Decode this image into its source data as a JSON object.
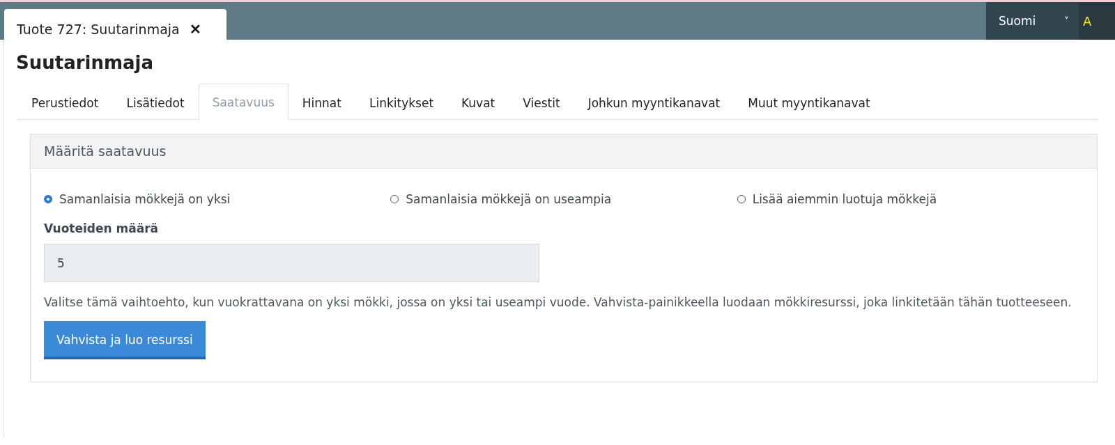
{
  "document_tab": {
    "title": "Tuote 727: Suutarinmaja",
    "close": "✕"
  },
  "language": {
    "value": "Suomi",
    "caret": "˅"
  },
  "top_right_cut": "A",
  "title": "Suutarinmaja",
  "tabs": [
    {
      "label": "Perustiedot",
      "selected": false
    },
    {
      "label": "Lisätiedot",
      "selected": false
    },
    {
      "label": "Saatavuus",
      "selected": true
    },
    {
      "label": "Hinnat",
      "selected": false
    },
    {
      "label": "Linkitykset",
      "selected": false
    },
    {
      "label": "Kuvat",
      "selected": false
    },
    {
      "label": "Viestit",
      "selected": false
    },
    {
      "label": "Johkun myyntikanavat",
      "selected": false
    },
    {
      "label": "Muut myyntikanavat",
      "selected": false
    }
  ],
  "panel": {
    "heading": "Määritä saatavuus",
    "options": [
      {
        "label": "Samanlaisia mökkejä on yksi",
        "selected": true
      },
      {
        "label": "Samanlaisia mökkejä on useampia",
        "selected": false
      },
      {
        "label": "Lisää aiemmin luotuja mökkejä",
        "selected": false
      }
    ],
    "field_label": "Vuoteiden määrä",
    "field_value": "5",
    "help": "Valitse tämä vaihtoehto, kun vuokrattavana on yksi mökki, jossa on yksi tai useampi vuode. Vahvista-painikkeella luodaan mökkiresurssi, joka linkitetään tähän tuotteeseen.",
    "button": "Vahvista ja luo resurssi"
  }
}
